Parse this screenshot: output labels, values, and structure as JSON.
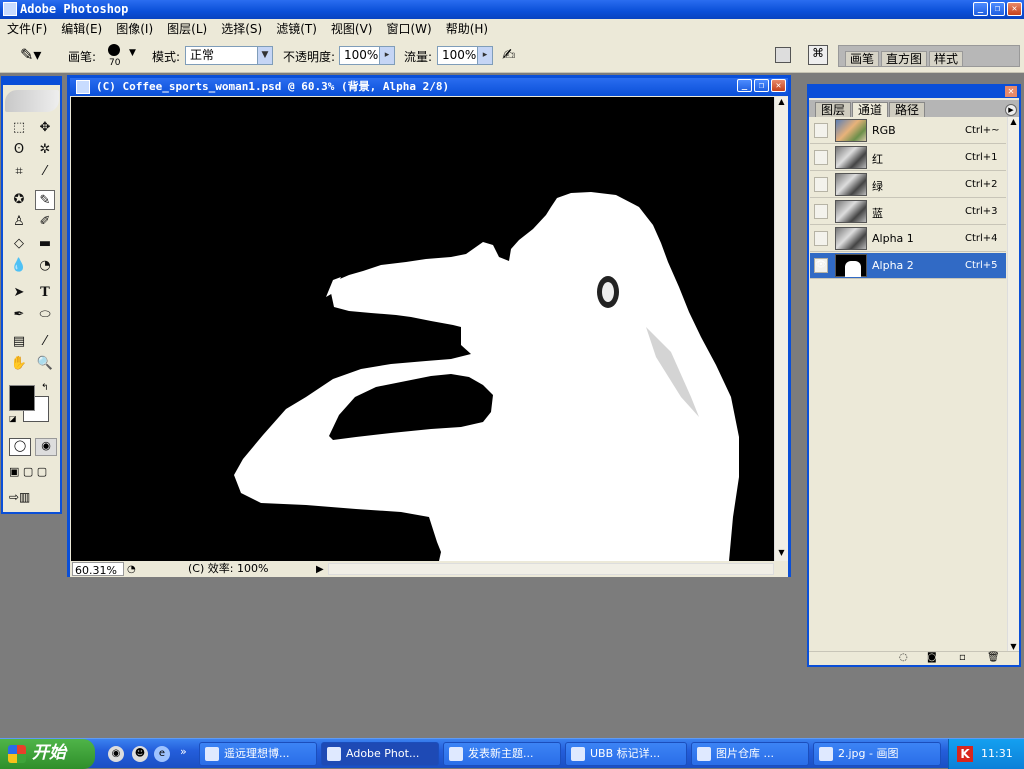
{
  "app": {
    "title": "Adobe Photoshop"
  },
  "menu": [
    "文件(F)",
    "编辑(E)",
    "图像(I)",
    "图层(L)",
    "选择(S)",
    "滤镜(T)",
    "视图(V)",
    "窗口(W)",
    "帮助(H)"
  ],
  "options": {
    "brush_label": "画笔:",
    "brush_size": "70",
    "mode_label": "模式:",
    "mode_value": "正常",
    "opacity_label": "不透明度:",
    "opacity_value": "100%",
    "flow_label": "流量:",
    "flow_value": "100%",
    "palette_tabs": [
      "画笔",
      "直方图",
      "样式"
    ]
  },
  "document": {
    "title": "(C) Coffee_sports_woman1.psd @ 60.3% (背景, Alpha 2/8)",
    "zoom": "60.31%",
    "status": "(C) 效率: 100%"
  },
  "channels_panel": {
    "tabs": [
      "图层",
      "通道",
      "路径"
    ],
    "active_tab": "通道",
    "channels": [
      {
        "name": "RGB",
        "shortcut": "Ctrl+~",
        "visible": false
      },
      {
        "name": "红",
        "shortcut": "Ctrl+1",
        "visible": false
      },
      {
        "name": "绿",
        "shortcut": "Ctrl+2",
        "visible": false
      },
      {
        "name": "蓝",
        "shortcut": "Ctrl+3",
        "visible": false
      },
      {
        "name": "Alpha 1",
        "shortcut": "Ctrl+4",
        "visible": false
      },
      {
        "name": "Alpha 2",
        "shortcut": "Ctrl+5",
        "visible": true,
        "selected": true
      }
    ]
  },
  "taskbar": {
    "start_label": "开始",
    "tasks": [
      {
        "label": "遥远理想博...",
        "active": false
      },
      {
        "label": "Adobe Phot...",
        "active": true
      },
      {
        "label": "发表新主题...",
        "active": false
      },
      {
        "label": "UBB 标记详...",
        "active": false
      },
      {
        "label": "图片仓库 ...",
        "active": false
      },
      {
        "label": "2.jpg - 画图",
        "active": false
      }
    ],
    "clock": "11:31"
  },
  "colors": {
    "xp_blue": "#0a4fd8",
    "selection": "#316ac5",
    "workspace": "#7c7c7c",
    "panel_bg": "#ece9d8"
  }
}
